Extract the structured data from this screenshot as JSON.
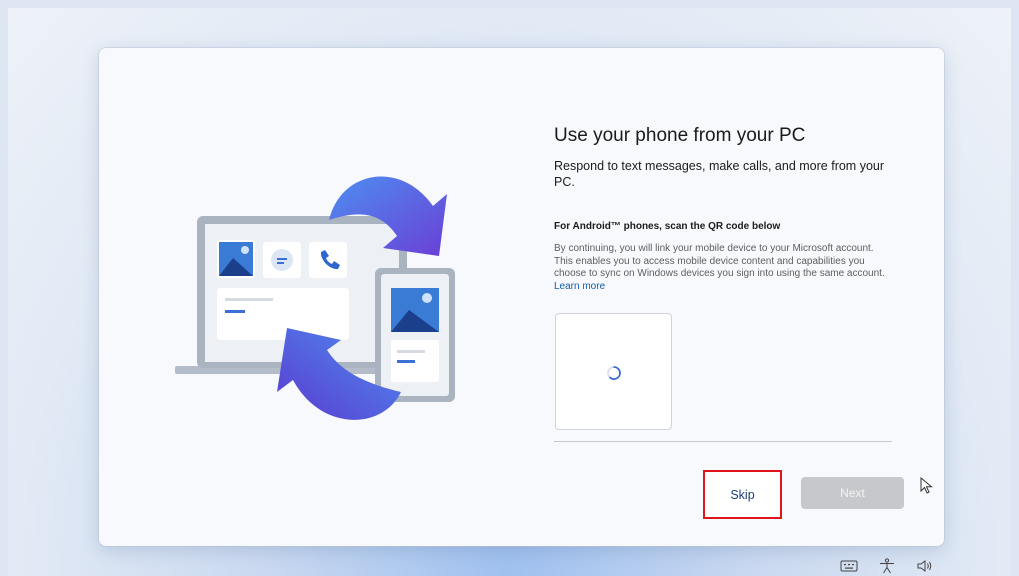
{
  "setup": {
    "title": "Use your phone from your PC",
    "description": "Respond to text messages, make calls, and more from your PC.",
    "android_heading": "For Android™ phones, scan the QR code below",
    "disclaimer": "By continuing, you will link your mobile device to your Microsoft account. This enables you to access mobile device content and capabilities you choose to sync on Windows devices you sign into using the same account.",
    "learn_more": "Learn more",
    "skip_label": "Skip",
    "next_label": "Next"
  },
  "icons": {
    "illustration": "phone-link-illustration",
    "qr_loading": "loading-spinner-icon",
    "cursor": "mouse-pointer-icon",
    "tray": [
      "keyboard-icon",
      "accessibility-icon",
      "volume-icon"
    ]
  },
  "colors": {
    "accent_blue": "#3a6fd8",
    "highlight_red": "#e0151c",
    "next_disabled": "#c6c8cc"
  }
}
